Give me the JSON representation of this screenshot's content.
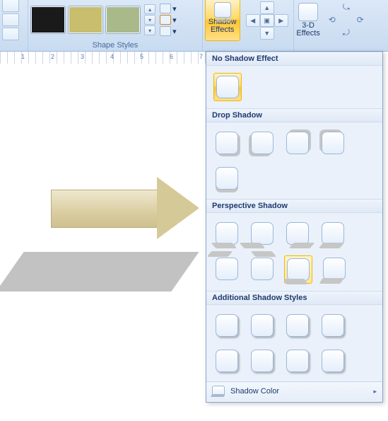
{
  "ribbon": {
    "groups": {
      "shape_styles": {
        "label": "Shape Styles"
      },
      "shadow_effects": {
        "label": "Shadow\nEffects",
        "split": "▾"
      },
      "three_d": {
        "label": "3-D\nEffects",
        "split": "▾"
      }
    }
  },
  "ruler": {
    "marks": [
      "1",
      "2",
      "3",
      "4",
      "5",
      "6",
      "7"
    ]
  },
  "gallery": {
    "sections": {
      "no_shadow": "No Shadow Effect",
      "drop": "Drop Shadow",
      "perspective": "Perspective Shadow",
      "additional": "Additional Shadow Styles"
    },
    "footer": {
      "label": "Shadow Color",
      "arrow": "▸"
    }
  }
}
